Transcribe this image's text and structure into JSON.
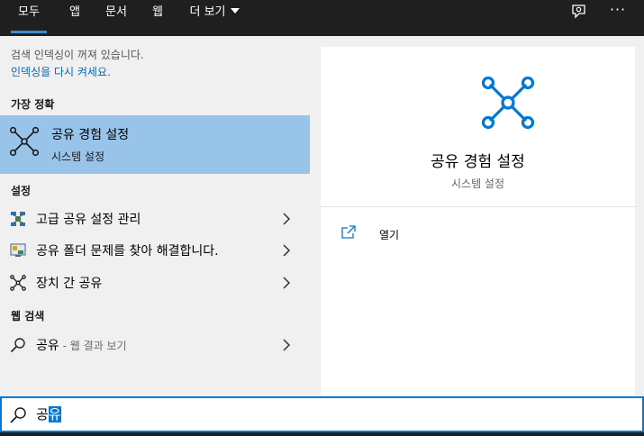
{
  "tabs": [
    {
      "label": "모두",
      "active": true
    },
    {
      "label": "앱"
    },
    {
      "label": "문서"
    },
    {
      "label": "웹"
    },
    {
      "label": "더 보기"
    }
  ],
  "topbar_icons": {
    "feedback": "feedback-icon",
    "more": "···"
  },
  "notice": {
    "text": "검색 인덱싱이 꺼져 있습니다.",
    "link": "인덱싱을 다시 켜세요."
  },
  "sections": {
    "best_match": "가장 정확",
    "settings": "설정",
    "web_search": "웹 검색"
  },
  "best_match": {
    "title": "공유 경험 설정",
    "subtitle": "시스템 설정",
    "icon": "shared-experiences-icon"
  },
  "settings_items": [
    {
      "label": "고급 공유 설정 관리",
      "icon": "network-sharing-icon"
    },
    {
      "label": "공유 폴더 문제를 찾아 해결합니다.",
      "icon": "troubleshoot-folder-icon"
    },
    {
      "label": "장치 간 공유",
      "icon": "shared-experiences-icon"
    }
  ],
  "web_item": {
    "label": "공유",
    "suffix": " - 웹 결과 보기",
    "icon": "search-icon"
  },
  "detail": {
    "title": "공유 경험 설정",
    "subtitle": "시스템 설정",
    "open_label": "열기"
  },
  "search": {
    "prefix": "공",
    "selected": "유"
  },
  "colors": {
    "accent": "#0078d7",
    "highlight": "#99c4ea",
    "link": "#0067b8",
    "topbar": "#1f1f1f"
  }
}
